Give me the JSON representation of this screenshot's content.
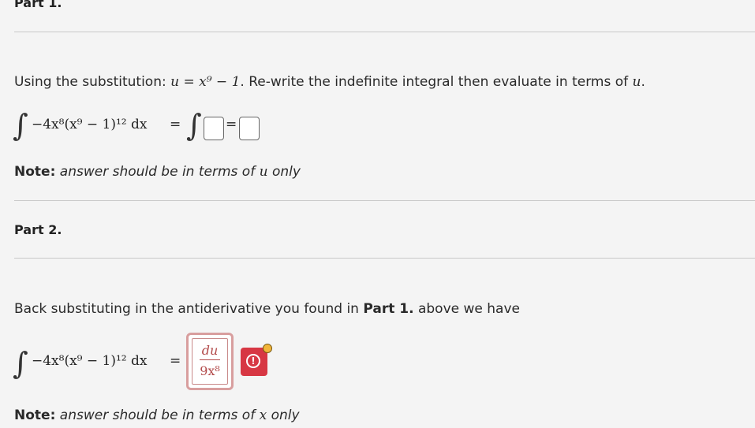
{
  "part1": {
    "heading": "Part 1.",
    "instruction_prefix": "Using the substitution: ",
    "substitution": "u = x⁹ − 1",
    "instruction_suffix": ". Re-write the indefinite integral then evaluate in terms of ",
    "instruction_var": "u",
    "instruction_end": ".",
    "integral_expression": "−4x⁸(x⁹ − 1)¹² dx",
    "equals": "=",
    "note_label": "Note:",
    "note_text": " answer should be in terms of ",
    "note_var": "u",
    "note_end": " only"
  },
  "part2": {
    "heading": "Part 2.",
    "instruction_prefix": "Back substituting in the antiderivative you found in ",
    "instruction_bold": "Part 1.",
    "instruction_suffix": " above we have",
    "integral_expression": "−4x⁸(x⁹ − 1)¹² dx",
    "equals": "=",
    "answer_numerator": "du",
    "answer_denominator": "9x⁸",
    "note_label": "Note:",
    "note_text": " answer should be in terms of ",
    "note_var": "x",
    "note_end": " only"
  },
  "colors": {
    "answer_border": "#d89e9e",
    "answer_text": "#b24a4a",
    "alert_button": "#d73743",
    "alert_dot": "#f2b53a"
  },
  "icons": {
    "alert": "exclamation-circle-icon",
    "status": "warning-dot-icon"
  }
}
